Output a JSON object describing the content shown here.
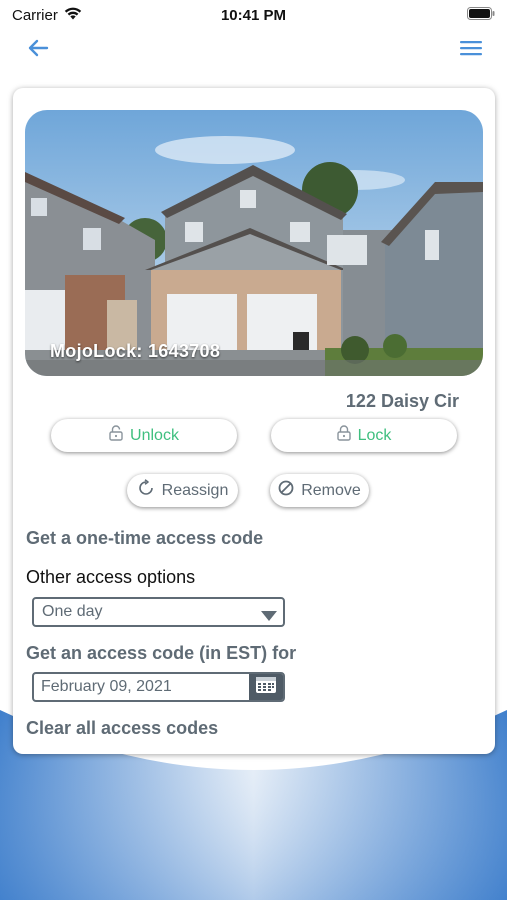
{
  "status_bar": {
    "carrier": "Carrier",
    "time": "10:41 PM"
  },
  "nav": {
    "back_icon": "arrow-left-icon",
    "menu_icon": "hamburger-menu-icon",
    "accent": "#4a90d9"
  },
  "lock": {
    "id_label": "MojoLock: 1643708",
    "address": "122 Daisy Cir"
  },
  "actions": {
    "unlock_label": "Unlock",
    "lock_label": "Lock",
    "reassign_label": "Reassign",
    "remove_label": "Remove",
    "green": "#3fbf7f"
  },
  "access": {
    "one_time_title": "Get a one-time access code",
    "other_options_label": "Other access options",
    "duration_selected": "One day",
    "code_for_title": "Get an access code (in EST) for",
    "date_value": "February 09, 2021",
    "clear_all_label": "Clear all access codes"
  }
}
